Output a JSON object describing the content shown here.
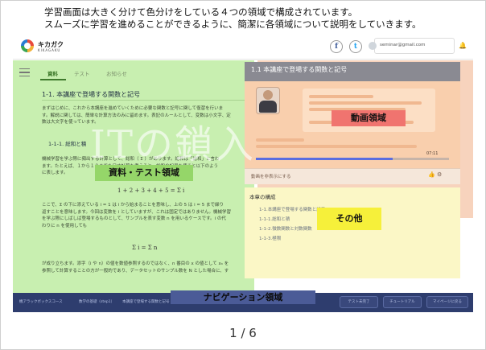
{
  "header": {
    "line1": "学習画面は大きく分けて色分けをしている４つの領域で構成されています。",
    "line2": "スムーズに学習を進めることができるように、簡潔に各領域について説明をしていきます。"
  },
  "topbar": {
    "logo_text": "キカガク",
    "logo_sub": "KIKAGAKU",
    "facebook": "f",
    "twitter": "t",
    "email": "seminar@gmail.com",
    "bell": "🔔"
  },
  "left": {
    "tabs": [
      "資料",
      "テスト",
      "お知らせ"
    ],
    "section_title": "1-1. 本講座で登場する関数と記号",
    "intro": [
      "まずはじめに、これから本講座を進めていくために必要な関数と記号に関して復習を行いま",
      "す。解説に関しては、簡単な計算方法のみに留めます。表記のルールとして、変数は小文字、定",
      "数は大文字を使っています。"
    ],
    "sub_title": "1-1-1. 総和と積",
    "body1": [
      "機械学習を学ぶ際に頻出する計算として、総和（ Σ ）があります。総和は「総和」と言わ",
      "ます。たとえば、１から１０までを足す計算を考えると、総和の記号を使うと以下のよう",
      "に表します。"
    ],
    "formula1": "1 + 2 + 3 + 4 + 5 = Σ i",
    "body2": [
      "ここで、Σ の下に添えている i = 1 は i から始まることを意味し、上の 5 は i = 5 まで繰り",
      "返すことを意味します。今回は変数を i としていますが、これは固定ではありません。機械学習",
      "を学ぶ際にしばしば登場するものとして、サンプルを表す変数 n を用いるケースです。i の代",
      "わりに n を使用しても"
    ],
    "formula2": "Σ i = Σ n",
    "body3": [
      "が成り立ちます。添字（i や n）の値を数値参照するのではなく、n 番目の x の値として xₙ を",
      "参照して計算することの方が一般的であり、データセットのサンプル数を N とした場合に、す"
    ],
    "region_label": "資料・テスト領域"
  },
  "video": {
    "title": "1.1  本講座で登場する関数と記号",
    "region_label": "動画領域",
    "time": "07:11",
    "control_text": "動画を非表示にする"
  },
  "other": {
    "title": "本章の構成",
    "items": [
      "1-1.本講座で登場する関数と記号",
      "1-1-1.総和と積",
      "1-1-2.微数関数と対数関数",
      "1-1-3.極限"
    ],
    "region_label": "その他"
  },
  "nav": {
    "crumbs": [
      "機アラックボックスコース",
      "数学の基礎（step1）",
      "本講座で登場する関数と記号"
    ],
    "buttons": [
      "テスト未完了",
      "チュートリアル",
      "マイページに戻る"
    ],
    "region_label": "ナビゲーション領域"
  },
  "watermark": "ITの鎖入",
  "pagination": "1 / 6"
}
